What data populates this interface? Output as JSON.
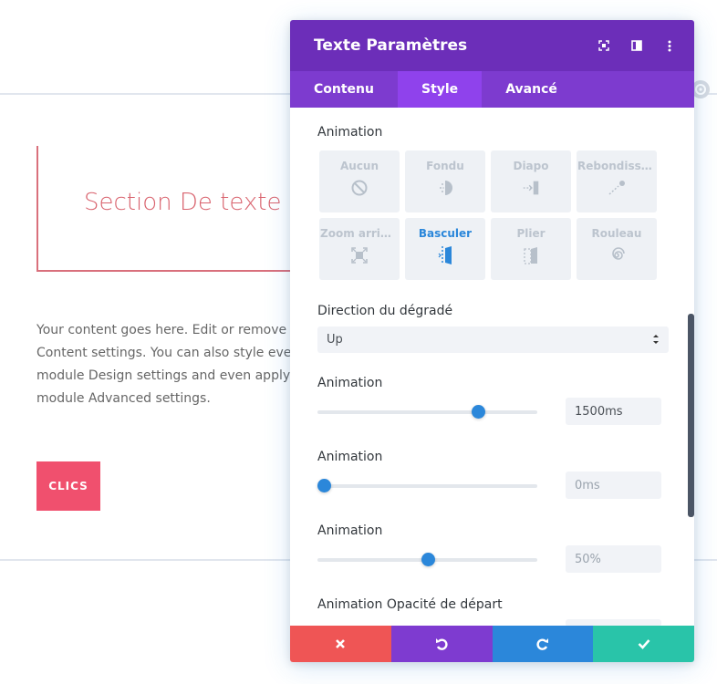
{
  "background": {
    "section_title": "Section De texte",
    "body_lines": [
      "Your content goes here. Edit or remove this",
      "Content settings. You can also style every a",
      "module Design settings and even apply cus",
      "module Advanced settings."
    ],
    "button_label": "CLICS"
  },
  "panel": {
    "title": "Texte Paramètres",
    "tabs": [
      {
        "label": "Contenu",
        "active": false
      },
      {
        "label": "Style",
        "active": true
      },
      {
        "label": "Avancé",
        "active": false
      }
    ],
    "animation_label": "Animation",
    "animation_options": [
      {
        "label": "Aucun",
        "icon": "none-icon",
        "active": false
      },
      {
        "label": "Fondu",
        "icon": "fade-icon",
        "active": false
      },
      {
        "label": "Diapo",
        "icon": "slide-icon",
        "active": false
      },
      {
        "label": "Rebondisse...",
        "icon": "bounce-icon",
        "active": false
      },
      {
        "label": "Zoom arrière",
        "icon": "zoom-icon",
        "active": false
      },
      {
        "label": "Basculer",
        "icon": "flip-icon",
        "active": true
      },
      {
        "label": "Plier",
        "icon": "fold-icon",
        "active": false
      },
      {
        "label": "Rouleau",
        "icon": "roll-icon",
        "active": false
      }
    ],
    "direction_label": "Direction du dégradé",
    "direction_value": "Up",
    "sliders": [
      {
        "label": "Animation",
        "value": "1500ms",
        "fraction": 0.73,
        "muted": false
      },
      {
        "label": "Animation",
        "value": "0ms",
        "fraction": 0.0,
        "muted": true
      },
      {
        "label": "Animation",
        "value": "50%",
        "fraction": 0.5,
        "muted": true
      }
    ],
    "opacity_label": "Animation Opacité de départ"
  },
  "colors": {
    "header": "#6c2eb9",
    "tabs": "#7d3bcf",
    "active_tab": "#8f42ec",
    "accent": "#2b87da",
    "discard": "#ef5555",
    "undo": "#7e3bd0",
    "redo": "#2b87da",
    "save": "#29c4a9"
  }
}
